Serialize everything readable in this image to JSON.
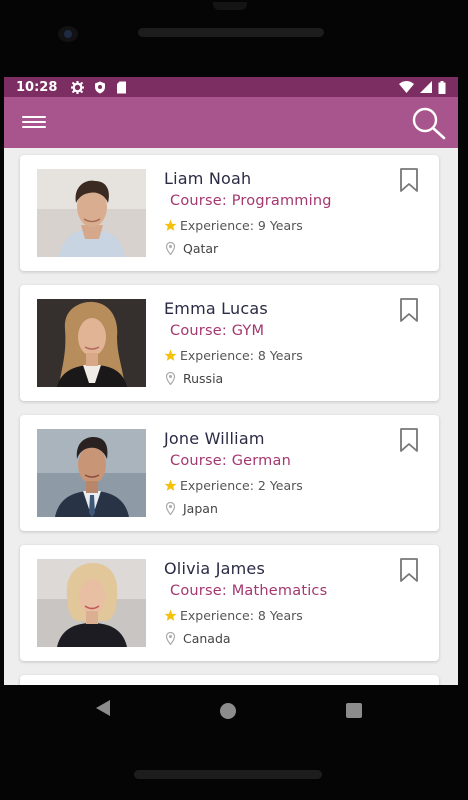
{
  "status_bar": {
    "time": "10:28"
  },
  "app_bar": {
    "menu_icon": "hamburger-menu-icon",
    "search_icon": "search-icon"
  },
  "instructors": [
    {
      "name": "Liam Noah",
      "course": "Course: Programming",
      "experience": "Experience: 9 Years",
      "location": "Qatar"
    },
    {
      "name": "Emma Lucas",
      "course": "Course: GYM",
      "experience": "Experience: 8 Years",
      "location": "Russia"
    },
    {
      "name": "Jone William",
      "course": "Course: German",
      "experience": "Experience: 2 Years",
      "location": "Japan"
    },
    {
      "name": "Olivia James",
      "course": "Course: Mathematics",
      "experience": "Experience: 8 Years",
      "location": "Canada"
    }
  ],
  "colors": {
    "app_bar": "#a8558d",
    "status_bar": "#7c2d61",
    "course_text": "#a3376f",
    "star": "#f4c20d"
  }
}
